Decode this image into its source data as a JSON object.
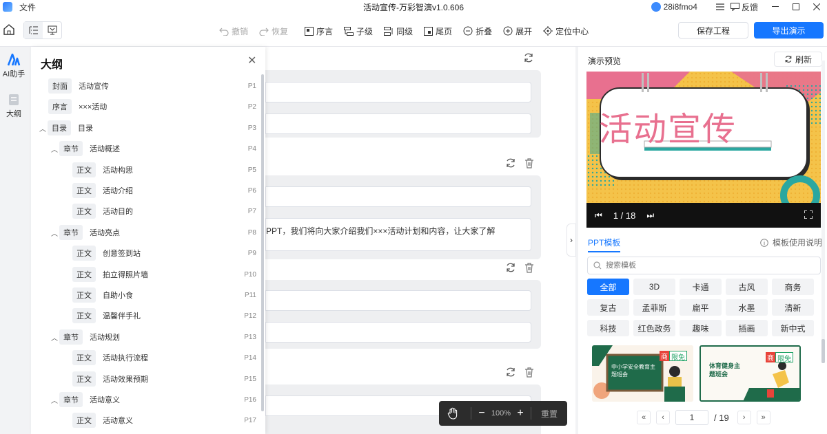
{
  "titlebar": {
    "menu_file": "文件",
    "title": "活动宣传-万彩智演v1.0.606",
    "user_name": "28i8fmo4",
    "feedback": "反馈"
  },
  "toolbar": {
    "undo": "撤销",
    "redo": "恢复",
    "preface": "序言",
    "child": "子级",
    "sibling": "同级",
    "ending": "尾页",
    "collapse": "折叠",
    "expand": "展开",
    "locate": "定位中心",
    "save": "保存工程",
    "export": "导出演示"
  },
  "leftrail": {
    "ai": "AI助手",
    "outline": "大纲"
  },
  "outline": {
    "title": "大纲",
    "rows": [
      {
        "tag": "封面",
        "text": "活动宣传",
        "page": "P1",
        "level": 0,
        "caret": ""
      },
      {
        "tag": "序言",
        "text": "×××活动",
        "page": "P2",
        "level": 0,
        "caret": ""
      },
      {
        "tag": "目录",
        "text": "目录",
        "page": "P3",
        "level": 0,
        "caret": "^"
      },
      {
        "tag": "章节",
        "text": "活动概述",
        "page": "P4",
        "level": 1,
        "caret": "^"
      },
      {
        "tag": "正文",
        "text": "活动构思",
        "page": "P5",
        "level": 2,
        "caret": ""
      },
      {
        "tag": "正文",
        "text": "活动介绍",
        "page": "P6",
        "level": 2,
        "caret": ""
      },
      {
        "tag": "正文",
        "text": "活动目的",
        "page": "P7",
        "level": 2,
        "caret": ""
      },
      {
        "tag": "章节",
        "text": "活动亮点",
        "page": "P8",
        "level": 1,
        "caret": "^"
      },
      {
        "tag": "正文",
        "text": "创意签到站",
        "page": "P9",
        "level": 2,
        "caret": ""
      },
      {
        "tag": "正文",
        "text": "拍立得照片墙",
        "page": "P10",
        "level": 2,
        "caret": ""
      },
      {
        "tag": "正文",
        "text": "自助小食",
        "page": "P11",
        "level": 2,
        "caret": ""
      },
      {
        "tag": "正文",
        "text": "温馨伴手礼",
        "page": "P12",
        "level": 2,
        "caret": ""
      },
      {
        "tag": "章节",
        "text": "活动规划",
        "page": "P13",
        "level": 1,
        "caret": "^"
      },
      {
        "tag": "正文",
        "text": "活动执行流程",
        "page": "P14",
        "level": 2,
        "caret": ""
      },
      {
        "tag": "正文",
        "text": "活动效果预期",
        "page": "P15",
        "level": 2,
        "caret": ""
      },
      {
        "tag": "章节",
        "text": "活动意义",
        "page": "P16",
        "level": 1,
        "caret": "^"
      },
      {
        "tag": "正文",
        "text": "活动意义",
        "page": "P17",
        "level": 2,
        "caret": ""
      }
    ]
  },
  "editor": {
    "preface_text": "PPT，我们将向大家介绍我们×××活动计划和内容，让大家了解"
  },
  "zoom": {
    "level": "100%",
    "reset": "重置"
  },
  "preview": {
    "title": "演示预览",
    "refresh": "刷新",
    "slide_title": "活动宣传",
    "slide_counter": "1 / 18",
    "tab_ppt": "PPT模板",
    "tab_help": "模板使用说明",
    "search_placeholder": "搜索模板",
    "categories": [
      "全部",
      "3D",
      "卡通",
      "古风",
      "商务",
      "复古",
      "孟菲斯",
      "扁平",
      "水墨",
      "清新",
      "科技",
      "红色政务",
      "趣味",
      "插画",
      "新中式"
    ],
    "thumbs": [
      {
        "badge1": "商",
        "badge2": "限免",
        "title": "中小学安全教育主题班会"
      },
      {
        "badge1": "商",
        "badge2": "限免",
        "title": "体育健身主题班会"
      }
    ],
    "pager_current": "1",
    "pager_total": "/ 19"
  },
  "colors": {
    "accent": "#1677ff",
    "slide_title": "#e8708f"
  }
}
